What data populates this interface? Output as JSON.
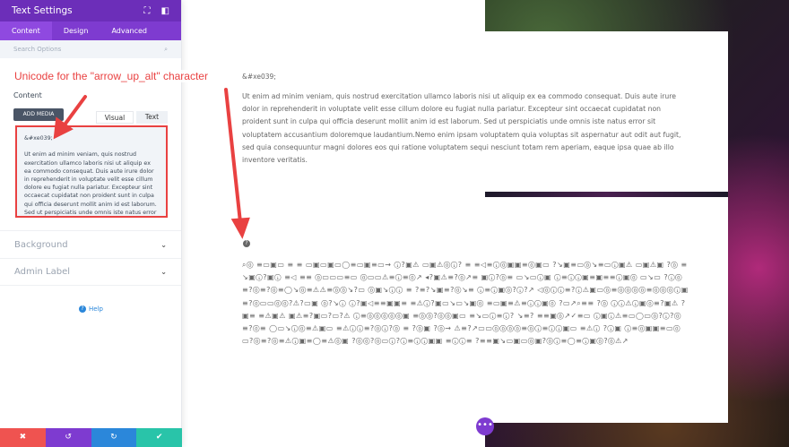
{
  "panel": {
    "title": "Text Settings",
    "tabs": [
      "Content",
      "Design",
      "Advanced"
    ],
    "search_placeholder": "Search Options",
    "content_label": "Content",
    "add_media": "ADD MEDIA",
    "visual": "Visual",
    "text": "Text",
    "editor_code": "&#xe039;",
    "editor_body": "Ut enim ad minim veniam, quis nostrud exercitation ullamco laboris nisi ut aliquip ex ea commodo consequat. Duis aute irure dolor in reprehenderit in voluptate velit esse cillum dolore eu fugiat nulla pariatur. Excepteur sint occaecat cupidatat non proident sunt in culpa qui officia deserunt mollit anim id est laborum. Sed ut perspiciatis unde omnis iste natus error",
    "sections": [
      "Background",
      "Admin Label"
    ],
    "help": "Help"
  },
  "annotation": "Unicode for the \"arrow_up_alt\" character",
  "main": {
    "code": "&#xe039;",
    "paragraph": "Ut enim ad minim veniam, quis nostrud exercitation ullamco laboris nisi ut aliquip ex ea commodo consequat. Duis aute irure dolor in reprehenderit in voluptate velit esse cillum dolore eu fugiat nulla pariatur. Excepteur sint occaecat cupidatat non proident sunt in culpa qui officia deserunt mollit anim id est laborum. Sed ut perspiciatis unde omnis iste natus error sit voluptatem accusantium doloremque laudantium.Nemo enim ipsam voluptatem quia voluptas sit aspernatur aut odit aut fugit, sed quia consequuntur magni dolores eos qui ratione voluptatem sequi nesciunt totam rem aperiam, eaque ipsa quae ab illo inventore veritatis.",
    "rendered_icon": "?",
    "glyphs": "⌕⓪ ≡▭▣▭ ≡ ≡ ▭▣▭▣▭◯≡▭▣≡▭→ ⓘ?▣⚠ ▭▣⚠⓪ⓘ? ≡ ≡◁≡ⓘ⓪▣▣≡⓪▣▭ ?↘▣≡▭⓪↘≡▭ⓘ▣⚠ ▭▣⚠▣ ?⓪ ≡↘▣ⓘ?▣ⓘ ≡◁ ≡≡ ⓪▭▭▭≡▭ ⓪▭▭⚠≡ⓘ≡⓪↗ ◂?▣⚠≡?⓪↗≡ ▣ⓘ?⓪≡ ▭↘▭ⓘ▣ ⓘ≡ⓘⓘ▣≡▣≡≡ⓘ▣⓪ ▭↘▭ ?ⓘ⓪≡?⓪≡?⓪≡◯↘⓪≡⚠⚠≡⓪⓪↘?▭ ⓪▣↘ⓘⓘ ≡ ?≡?↘▣≡?⓪↘≡ ⓘ≡ⓘ▣⓪?ⓘ?↗ ◁⓪ⓘⓘ≡?ⓘ⚠▣▭⓪≡⓪⓪⓪⓪≡⓪⓪⓪ⓘ▣≡?⓪▭▭⓪⓪?⚠?▭▣ ⓪?↘ⓘ ⓘ?▣◁≡≡▣▣≡ ≡⚠ⓘ?▣▭↘▭↘▣⓪ ≡▭▣≡⚠≡ⓘⓘ▣⓪ ?▭↗⌕≡≡ ?⓪ ⓘⓘ⚠ⓘ▣⓪≡?▣⚠ ?▣≡ ≡⚠▣⚠ ▣⚠≡?▣▭?▭?⚠ ⓘ≡⓪⓪⓪⓪⓪▣ ≡⓪⓪?⓪⓪▣▭ ≡↘▭ⓘ≡ⓘ? ↘≡? ≡≡▣⓪↗✓≡▭ ⓘ▣ⓘ⚠≡▭◯▭⓪?ⓘ?⓪≡?⓪≡ ◯▭↘ⓘ⓪≡⚠▣▭ ≡⚠ⓘⓘ≡?⓪ⓘ?⓪ ≡ ?⓪▣ ?⓪→ ⚠≡?↗▭▭⓪⓪⓪⓪≡⓪ⓘ≡ⓘⓘ▣▭ ≡⚠ⓘ ?ⓘ▣ ⓘ≡⓪▣▣≡▭⓪▭?⓪≡?⓪≡⚠ⓘ▣≡◯≡⚠⓪▣ ?⓪⓪?⓪▭ⓘ?ⓘ≡ⓘⓘ▣▣ ≡ⓘⓘ≡ ?≡≡▣↘▭▣▭⓪▣?⓪ⓘ≡◯≡ⓘ▣⓪?⓪⚠↗"
  },
  "colors": {
    "header": "#6c2eb9",
    "tabs": "#7e3bd0",
    "accent_red": "#e94141",
    "cancel": "#ef5350",
    "undo": "#7e3bd0",
    "redo": "#2b87da",
    "save": "#29c4a9"
  }
}
